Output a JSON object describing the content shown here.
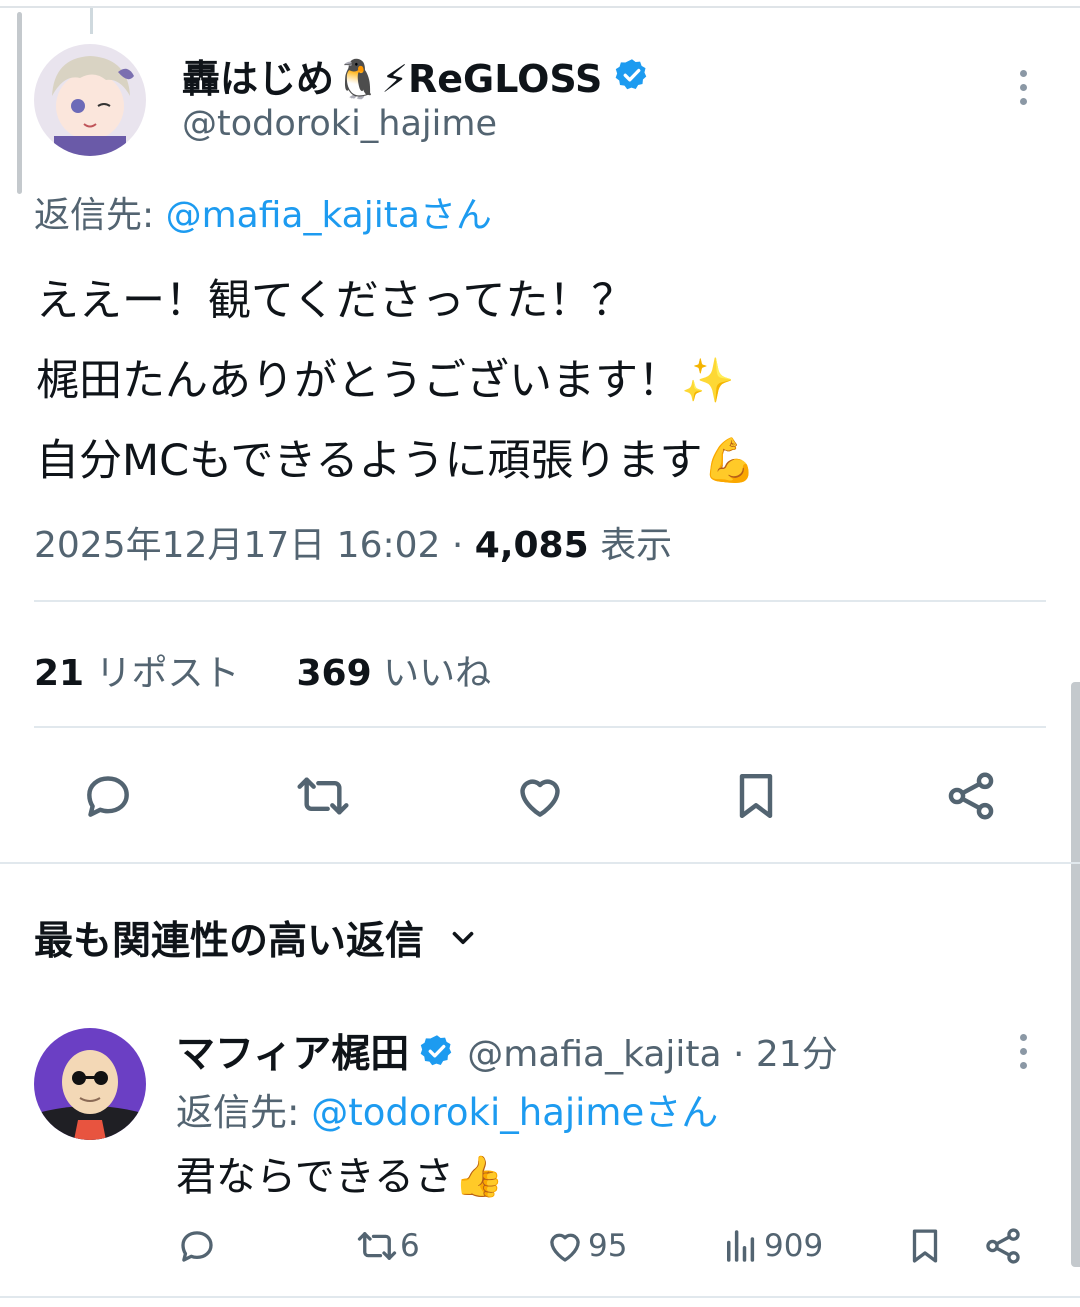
{
  "tweet": {
    "author_name": "轟はじめ🐧⚡ReGLOSS",
    "author_handle": "@todoroki_hajime",
    "reply_to_label": "返信先: ",
    "reply_to_mention": "@mafia_kajitaさん",
    "text_lines": [
      "ええー！観てくださってた！？",
      "梶田たんありがとうございます！✨",
      "自分MCもできるように頑張ります💪"
    ],
    "timestamp": "2025年12月17日 16:02",
    "separator": " · ",
    "views_count": "4,085",
    "views_label": " 表示",
    "reposts_count": "21",
    "reposts_label": " リポスト",
    "likes_count": "369",
    "likes_label": " いいね"
  },
  "section": {
    "title": "最も関連性の高い返信"
  },
  "reply": {
    "author_name": "マフィア梶田",
    "author_handle_time": "@mafia_kajita · 21分",
    "reply_to_label": "返信先: ",
    "reply_to_mention": "@todoroki_hajimeさん",
    "text": "君ならできるさ👍",
    "retweets": "6",
    "likes": "95",
    "views": "909"
  },
  "colors": {
    "accent": "#1d9bf0",
    "secondary_text": "#536471",
    "primary_text": "#0f1419",
    "divider": "#e1e8ed"
  },
  "icons": [
    "verified-badge-icon",
    "more-options-icon",
    "reply-icon",
    "retweet-icon",
    "like-icon",
    "bookmark-icon",
    "share-icon",
    "chevron-down-icon",
    "views-icon"
  ]
}
